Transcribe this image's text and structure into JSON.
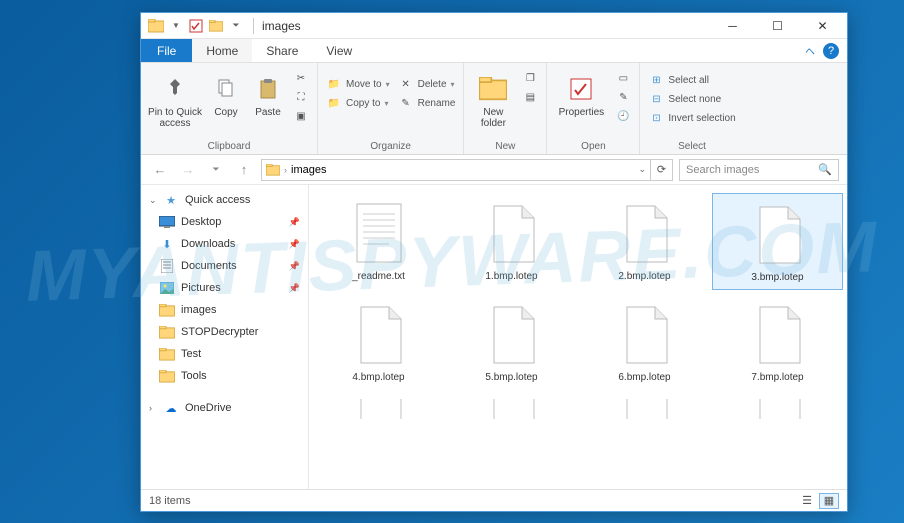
{
  "watermark": "MYANTISPYWARE.COM",
  "window": {
    "title": "images"
  },
  "tabs": {
    "file": "File",
    "home": "Home",
    "share": "Share",
    "view": "View"
  },
  "ribbon": {
    "clipboard": {
      "pin": "Pin to Quick access",
      "copy": "Copy",
      "paste": "Paste",
      "label": "Clipboard"
    },
    "organize": {
      "moveto": "Move to",
      "copyto": "Copy to",
      "delete": "Delete",
      "rename": "Rename",
      "label": "Organize"
    },
    "new": {
      "folder": "New folder",
      "label": "New"
    },
    "open": {
      "properties": "Properties",
      "label": "Open"
    },
    "select": {
      "all": "Select all",
      "none": "Select none",
      "invert": "Invert selection",
      "label": "Select"
    }
  },
  "address": {
    "current": "images"
  },
  "search": {
    "placeholder": "Search images"
  },
  "sidebar": {
    "quickaccess": "Quick access",
    "items": [
      {
        "label": "Desktop",
        "pinned": true,
        "icon": "desktop"
      },
      {
        "label": "Downloads",
        "pinned": true,
        "icon": "downloads"
      },
      {
        "label": "Documents",
        "pinned": true,
        "icon": "documents"
      },
      {
        "label": "Pictures",
        "pinned": true,
        "icon": "pictures"
      },
      {
        "label": "images",
        "pinned": false,
        "icon": "folder"
      },
      {
        "label": "STOPDecrypter",
        "pinned": false,
        "icon": "folder"
      },
      {
        "label": "Test",
        "pinned": false,
        "icon": "folder"
      },
      {
        "label": "Tools",
        "pinned": false,
        "icon": "folder"
      }
    ],
    "onedrive": "OneDrive"
  },
  "files": [
    {
      "name": "_readme.txt",
      "type": "txt",
      "selected": false
    },
    {
      "name": "1.bmp.lotep",
      "type": "unknown",
      "selected": false
    },
    {
      "name": "2.bmp.lotep",
      "type": "unknown",
      "selected": false
    },
    {
      "name": "3.bmp.lotep",
      "type": "unknown",
      "selected": true
    },
    {
      "name": "4.bmp.lotep",
      "type": "unknown",
      "selected": false
    },
    {
      "name": "5.bmp.lotep",
      "type": "unknown",
      "selected": false
    },
    {
      "name": "6.bmp.lotep",
      "type": "unknown",
      "selected": false
    },
    {
      "name": "7.bmp.lotep",
      "type": "unknown",
      "selected": false
    }
  ],
  "status": {
    "count": "18 items"
  }
}
